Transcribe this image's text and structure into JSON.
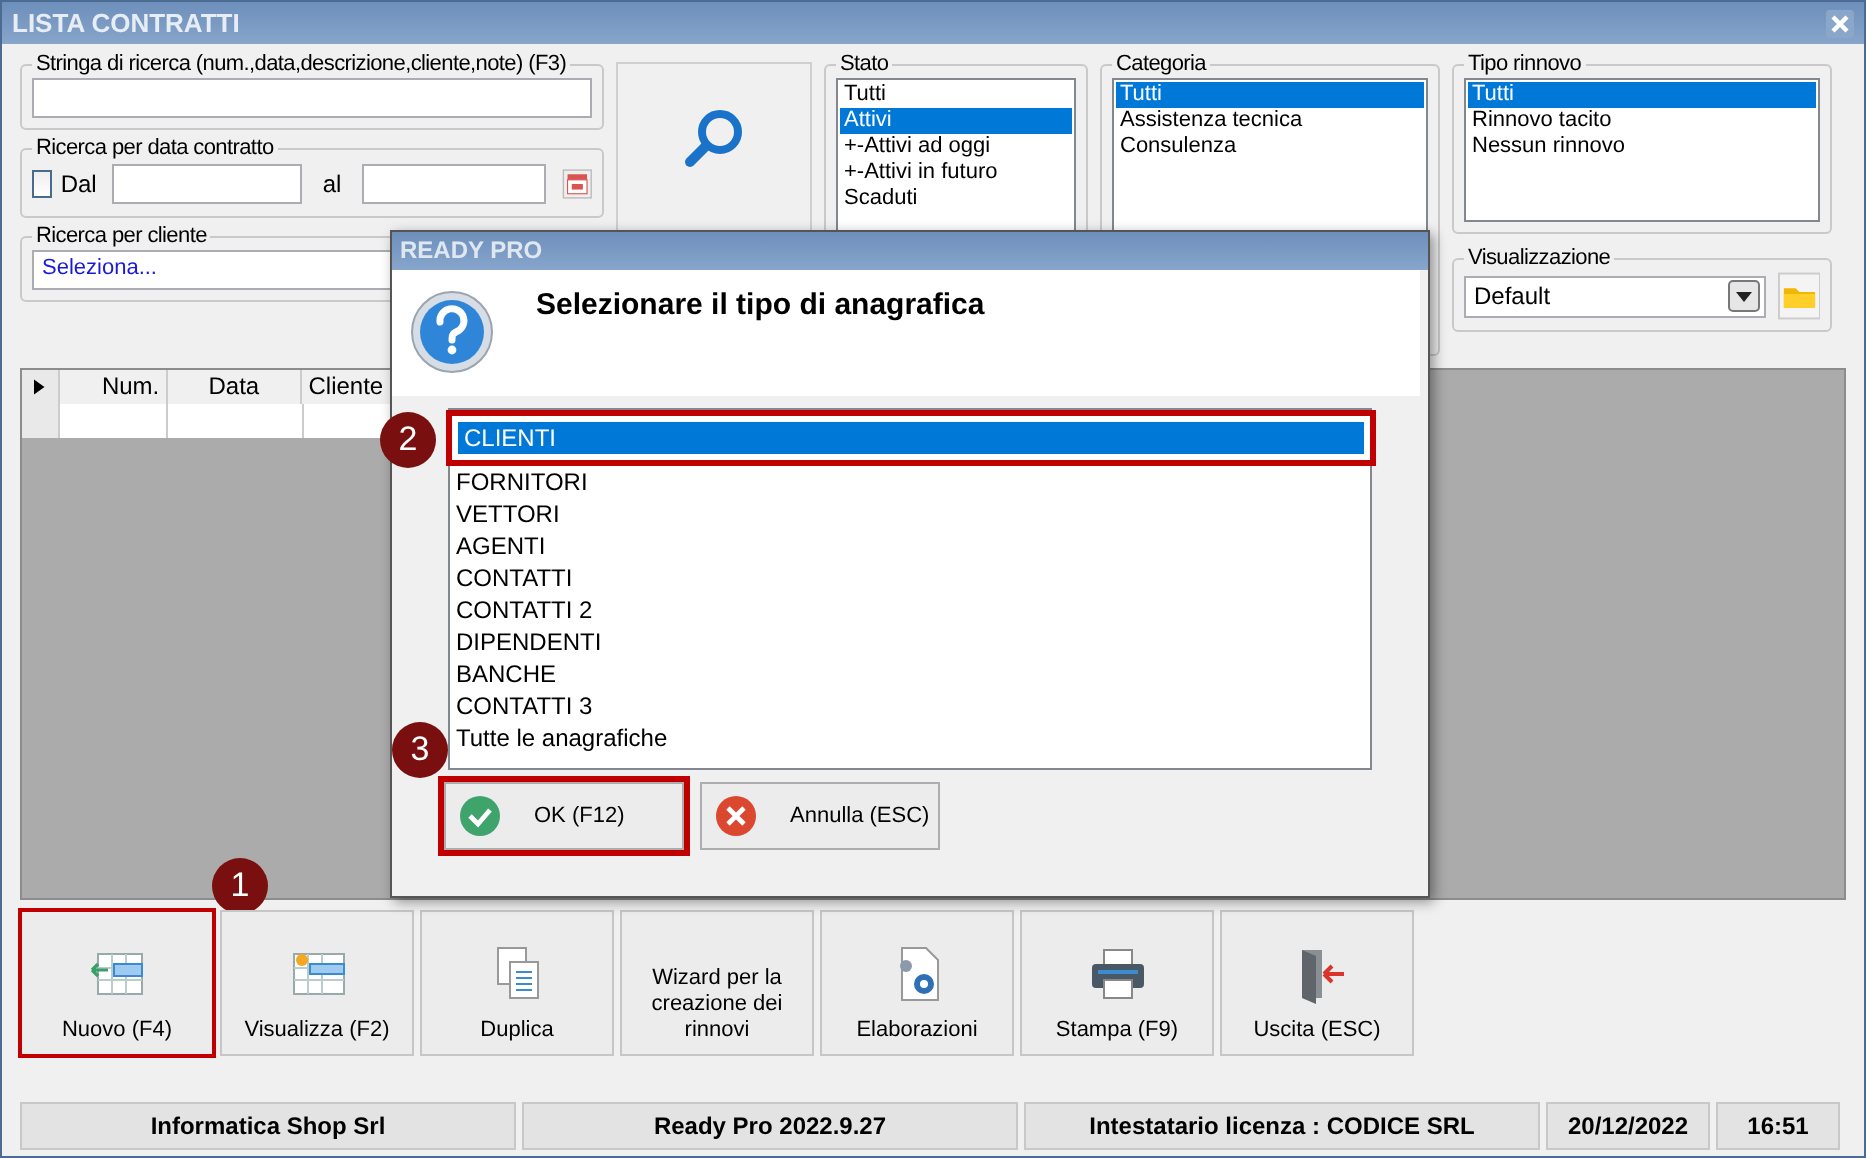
{
  "window": {
    "title": "LISTA CONTRATTI"
  },
  "search": {
    "label": "Stringa di ricerca (num.,data,descrizione,cliente,note) (F3)"
  },
  "date_filter": {
    "label": "Ricerca per data contratto",
    "checkbox_label": "Dal",
    "checked": false,
    "to_label": "al"
  },
  "customer_filter": {
    "label": "Ricerca per cliente",
    "value": "Seleziona..."
  },
  "stato": {
    "label": "Stato",
    "items": [
      {
        "label": "Tutti",
        "selected": false
      },
      {
        "label": "Attivi",
        "selected": true
      },
      {
        "label": "+-Attivi ad oggi",
        "selected": false
      },
      {
        "label": "+-Attivi in futuro",
        "selected": false
      },
      {
        "label": "Scaduti",
        "selected": false
      }
    ]
  },
  "categoria": {
    "label": "Categoria",
    "items": [
      {
        "label": "Tutti",
        "selected": true
      },
      {
        "label": "Assistenza tecnica",
        "selected": false
      },
      {
        "label": "Consulenza",
        "selected": false
      }
    ]
  },
  "tipo_rinnovo": {
    "label": "Tipo rinnovo",
    "items": [
      {
        "label": "Tutti",
        "selected": true
      },
      {
        "label": "Rinnovo tacito",
        "selected": false
      },
      {
        "label": "Nessun rinnovo",
        "selected": false
      }
    ]
  },
  "visualizzazione": {
    "label": "Visualizzazione",
    "value": "Default"
  },
  "table": {
    "columns": [
      "Num.",
      "Data",
      "Cliente"
    ]
  },
  "toolbar": [
    {
      "label": "Nuovo (F4)",
      "callout": "1"
    },
    {
      "label": "Visualizza (F2)"
    },
    {
      "label": "Duplica"
    },
    {
      "label": "Wizard per la creazione dei rinnovi"
    },
    {
      "label": "Elaborazioni"
    },
    {
      "label": "Stampa (F9)"
    },
    {
      "label": "Uscita (ESC)"
    }
  ],
  "dialog": {
    "title": "READY PRO",
    "message": "Selezionare il tipo di anagrafica",
    "items": [
      {
        "label": "CLIENTI",
        "selected": true,
        "callout": "2"
      },
      {
        "label": "FORNITORI",
        "selected": false
      },
      {
        "label": "VETTORI",
        "selected": false
      },
      {
        "label": "AGENTI",
        "selected": false
      },
      {
        "label": "CONTATTI",
        "selected": false
      },
      {
        "label": "CONTATTI 2",
        "selected": false
      },
      {
        "label": "DIPENDENTI",
        "selected": false
      },
      {
        "label": "BANCHE",
        "selected": false
      },
      {
        "label": "CONTATTI 3",
        "selected": false
      },
      {
        "label": "Tutte le anagrafiche",
        "selected": false
      }
    ],
    "buttons": [
      {
        "kind": "ok",
        "label": "OK (F12)",
        "callout": "3"
      },
      {
        "kind": "cancel",
        "label": "Annulla (ESC)"
      }
    ]
  },
  "status_bar": [
    "Informatica Shop Srl",
    "Ready Pro 2022.9.27",
    "Intestatario licenza : CODICE SRL",
    "20/12/2022",
    "16:51"
  ]
}
